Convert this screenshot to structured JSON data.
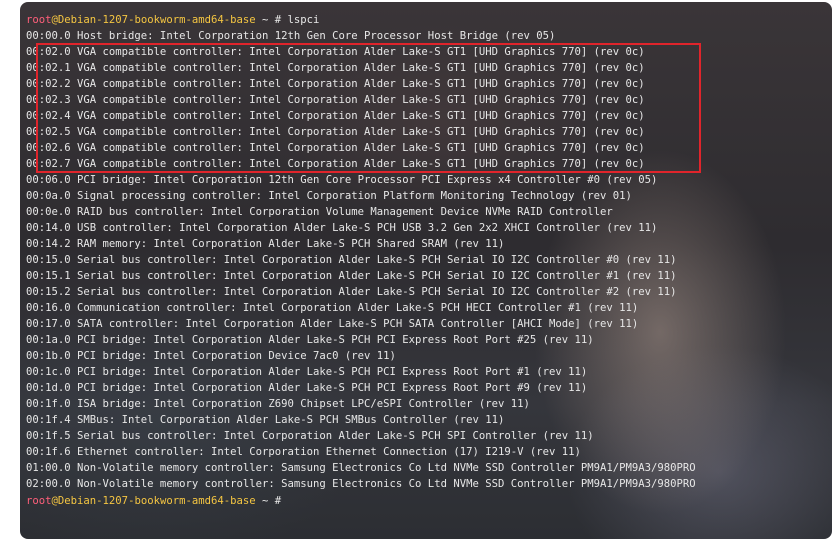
{
  "prompt": {
    "user": "root",
    "at": "@",
    "host": "Debian-1207-bookworm-amd64-base",
    "path": " ~ ",
    "symbol": "# ",
    "command": "lspci"
  },
  "output_lines": [
    "00:00.0 Host bridge: Intel Corporation 12th Gen Core Processor Host Bridge (rev 05)",
    "00:02.0 VGA compatible controller: Intel Corporation Alder Lake-S GT1 [UHD Graphics 770] (rev 0c)",
    "00:02.1 VGA compatible controller: Intel Corporation Alder Lake-S GT1 [UHD Graphics 770] (rev 0c)",
    "00:02.2 VGA compatible controller: Intel Corporation Alder Lake-S GT1 [UHD Graphics 770] (rev 0c)",
    "00:02.3 VGA compatible controller: Intel Corporation Alder Lake-S GT1 [UHD Graphics 770] (rev 0c)",
    "00:02.4 VGA compatible controller: Intel Corporation Alder Lake-S GT1 [UHD Graphics 770] (rev 0c)",
    "00:02.5 VGA compatible controller: Intel Corporation Alder Lake-S GT1 [UHD Graphics 770] (rev 0c)",
    "00:02.6 VGA compatible controller: Intel Corporation Alder Lake-S GT1 [UHD Graphics 770] (rev 0c)",
    "00:02.7 VGA compatible controller: Intel Corporation Alder Lake-S GT1 [UHD Graphics 770] (rev 0c)",
    "00:06.0 PCI bridge: Intel Corporation 12th Gen Core Processor PCI Express x4 Controller #0 (rev 05)",
    "00:0a.0 Signal processing controller: Intel Corporation Platform Monitoring Technology (rev 01)",
    "00:0e.0 RAID bus controller: Intel Corporation Volume Management Device NVMe RAID Controller",
    "00:14.0 USB controller: Intel Corporation Alder Lake-S PCH USB 3.2 Gen 2x2 XHCI Controller (rev 11)",
    "00:14.2 RAM memory: Intel Corporation Alder Lake-S PCH Shared SRAM (rev 11)",
    "00:15.0 Serial bus controller: Intel Corporation Alder Lake-S PCH Serial IO I2C Controller #0 (rev 11)",
    "00:15.1 Serial bus controller: Intel Corporation Alder Lake-S PCH Serial IO I2C Controller #1 (rev 11)",
    "00:15.2 Serial bus controller: Intel Corporation Alder Lake-S PCH Serial IO I2C Controller #2 (rev 11)",
    "00:16.0 Communication controller: Intel Corporation Alder Lake-S PCH HECI Controller #1 (rev 11)",
    "00:17.0 SATA controller: Intel Corporation Alder Lake-S PCH SATA Controller [AHCI Mode] (rev 11)",
    "00:1a.0 PCI bridge: Intel Corporation Alder Lake-S PCH PCI Express Root Port #25 (rev 11)",
    "00:1b.0 PCI bridge: Intel Corporation Device 7ac0 (rev 11)",
    "00:1c.0 PCI bridge: Intel Corporation Alder Lake-S PCH PCI Express Root Port #1 (rev 11)",
    "00:1d.0 PCI bridge: Intel Corporation Alder Lake-S PCH PCI Express Root Port #9 (rev 11)",
    "00:1f.0 ISA bridge: Intel Corporation Z690 Chipset LPC/eSPI Controller (rev 11)",
    "00:1f.4 SMBus: Intel Corporation Alder Lake-S PCH SMBus Controller (rev 11)",
    "00:1f.5 Serial bus controller: Intel Corporation Alder Lake-S PCH SPI Controller (rev 11)",
    "00:1f.6 Ethernet controller: Intel Corporation Ethernet Connection (17) I219-V (rev 11)",
    "01:00.0 Non-Volatile memory controller: Samsung Electronics Co Ltd NVMe SSD Controller PM9A1/PM9A3/980PRO",
    "02:00.0 Non-Volatile memory controller: Samsung Electronics Co Ltd NVMe SSD Controller PM9A1/PM9A3/980PRO"
  ],
  "colors": {
    "user": "#ff5f7a",
    "host": "#f4c542",
    "text": "#e7e7e7",
    "highlight_box": "#e0242b"
  }
}
